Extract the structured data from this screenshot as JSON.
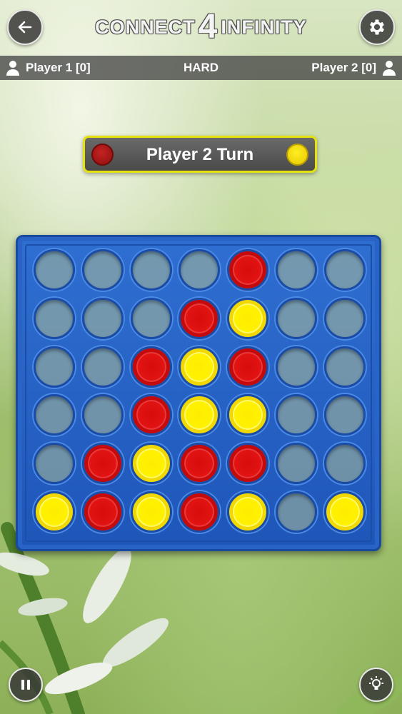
{
  "header": {
    "logo_word_1": "CONNECT",
    "logo_word_2": "4",
    "logo_word_3": "INFINITY",
    "back_icon": "arrow-left-icon",
    "settings_icon": "gear-icon"
  },
  "status": {
    "player1": "Player 1 [0]",
    "difficulty": "HARD",
    "player2": "Player 2 [0]"
  },
  "turn": {
    "text": "Player 2 Turn"
  },
  "board": {
    "rows": 6,
    "cols": 7,
    "cells": [
      [
        "empty",
        "empty",
        "empty",
        "empty",
        "red",
        "empty",
        "empty"
      ],
      [
        "empty",
        "empty",
        "empty",
        "red",
        "yellow",
        "empty",
        "empty"
      ],
      [
        "empty",
        "empty",
        "red",
        "yellow",
        "red",
        "empty",
        "empty"
      ],
      [
        "empty",
        "empty",
        "red",
        "yellow",
        "yellow",
        "empty",
        "empty"
      ],
      [
        "empty",
        "red",
        "yellow",
        "red",
        "red",
        "empty",
        "empty"
      ],
      [
        "yellow",
        "red",
        "yellow",
        "red",
        "yellow",
        "empty",
        "yellow"
      ]
    ]
  },
  "colors": {
    "red": "#e21414",
    "yellow": "#fff200",
    "board_blue": "#2f6fd1",
    "banner_border": "#e6e20f"
  },
  "footer": {
    "pause_icon": "pause-icon",
    "hint_icon": "lightbulb-icon"
  }
}
